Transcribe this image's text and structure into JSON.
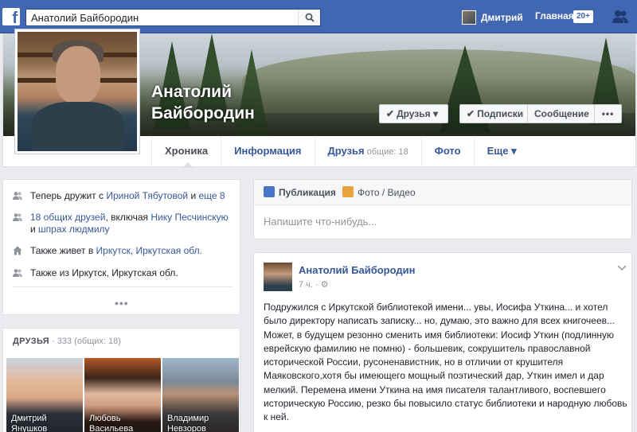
{
  "header": {
    "search_value": "Анатолий Байбородин",
    "user_name": "Дмитрий",
    "home_label": "Главная",
    "home_badge": "20+"
  },
  "profile": {
    "name_line1": "Анатолий",
    "name_line2": "Байбородин",
    "buttons": {
      "friends": "Друзья",
      "follow": "Подписки",
      "message": "Сообщение",
      "more": "•••"
    },
    "tabs": [
      {
        "label": "Хроника"
      },
      {
        "label": "Информация"
      },
      {
        "label": "Друзья",
        "count": "общие: 18"
      },
      {
        "label": "Фото"
      },
      {
        "label": "Еще"
      }
    ]
  },
  "intro": {
    "row1_prefix": "Теперь дружит с ",
    "row1_link1": "Ириной Тябутовой",
    "row1_mid": " и ",
    "row1_link2": "еще 8",
    "row2_link1": "18 общих друзей",
    "row2_mid": ", включая ",
    "row2_link2": "Нику Песчинскую",
    "row2_and": " и ",
    "row2_link3": "шпрах людмилу",
    "row3_prefix": "Также живет в ",
    "row3_link": "Иркутск, Иркутская обл.",
    "row4_text": "Также из Иркутск, Иркутская обл.",
    "more": "•••"
  },
  "friends_card": {
    "title": "ДРУЗЬЯ",
    "subtitle": " · 333 (общих: 18)",
    "friends": [
      {
        "line1": "Дмитрий",
        "line2": "Янушков"
      },
      {
        "line1": "Любовь",
        "line2": "Васильева"
      },
      {
        "line1": "Владимир",
        "line2": "Невзоров"
      }
    ]
  },
  "composer": {
    "tab_post": "Публикация",
    "tab_photo": "Фото / Видео",
    "placeholder": "Напишите что-нибудь..."
  },
  "post": {
    "author": "Анатолий Байбородин",
    "time": "7 ч. · ",
    "text": "Подружился с Иркутской библиотекой имени... увы, Иосифа Уткина... и хотел было директору написать записку... но, думаю, это важно для всех книгочеев... Может, в будущем резонно сменить имя библиотеки: Иосиф Уткин (подлинную еврейскую фамилию не помню) - большевик, сокрушитель православной исторической России, русоненавистник, но в отличии от крушителя Маяковского,хотя бы имеющего мощный поэтический дар, Уткин имел и дар мелкий. Перемена имени Уткина на имя писателя талантливого, воспевшего историческую Россию, резко бы повысило статус библиотеки и народную любовь к ней."
  },
  "colors": {
    "brand": "#4267b2",
    "link": "#365899",
    "page_bg": "#e9ebee"
  }
}
